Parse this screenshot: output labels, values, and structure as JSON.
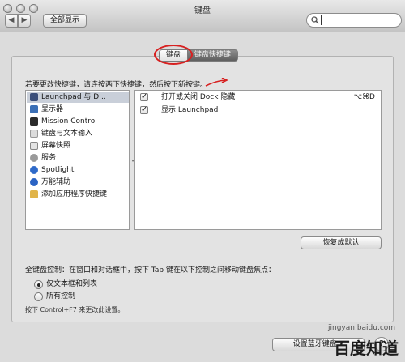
{
  "window": {
    "title": "键盘",
    "back_glyph": "◀",
    "forward_glyph": "▶",
    "show_all": "全部显示",
    "search_value": "",
    "search_placeholder": ""
  },
  "tabs": [
    {
      "label": "键盘",
      "active": true
    },
    {
      "label": "键盘快捷键",
      "active": false
    }
  ],
  "shortcuts_pane": {
    "instruction": "若要更改快捷键，请连按两下快捷键，然后按下新按键。",
    "categories": [
      {
        "label": "Launchpad 与 D...",
        "icon": "launchpad-icon",
        "selected": true
      },
      {
        "label": "显示器",
        "icon": "display-icon",
        "selected": false
      },
      {
        "label": "Mission Control",
        "icon": "mission-control-icon",
        "selected": false
      },
      {
        "label": "键盘与文本输入",
        "icon": "keyboard-icon",
        "selected": false
      },
      {
        "label": "屏幕快照",
        "icon": "screenshot-icon",
        "selected": false
      },
      {
        "label": "服务",
        "icon": "services-gear-icon",
        "selected": false
      },
      {
        "label": "Spotlight",
        "icon": "spotlight-icon",
        "selected": false
      },
      {
        "label": "万能辅助",
        "icon": "accessibility-icon",
        "selected": false
      },
      {
        "label": "添加应用程序快捷键",
        "icon": "app-shortcuts-icon",
        "selected": false
      }
    ],
    "shortcuts": [
      {
        "checked": true,
        "label": "打开或关闭 Dock 隐藏",
        "keys": "⌥⌘D"
      },
      {
        "checked": true,
        "label": "显示 Launchpad",
        "keys": ""
      }
    ],
    "restore_defaults": "恢复成默认"
  },
  "full_keyboard_access": {
    "label": "全键盘控制：在窗口和对话框中，按下 Tab 键在以下控制之间移动键盘焦点：",
    "options": [
      {
        "label": "仅文本框和列表",
        "selected": true
      },
      {
        "label": "所有控制",
        "selected": false
      }
    ],
    "hint": "按下 Control+F7 来更改此设置。"
  },
  "bluetooth_button": "设置蓝牙键盘...",
  "help_button": "?",
  "watermark": {
    "text": "百度知道",
    "url": "jingyan.baidu.com"
  },
  "colors": {
    "highlight_circle": "#d72020",
    "selected_row": "#c9cfd9"
  }
}
